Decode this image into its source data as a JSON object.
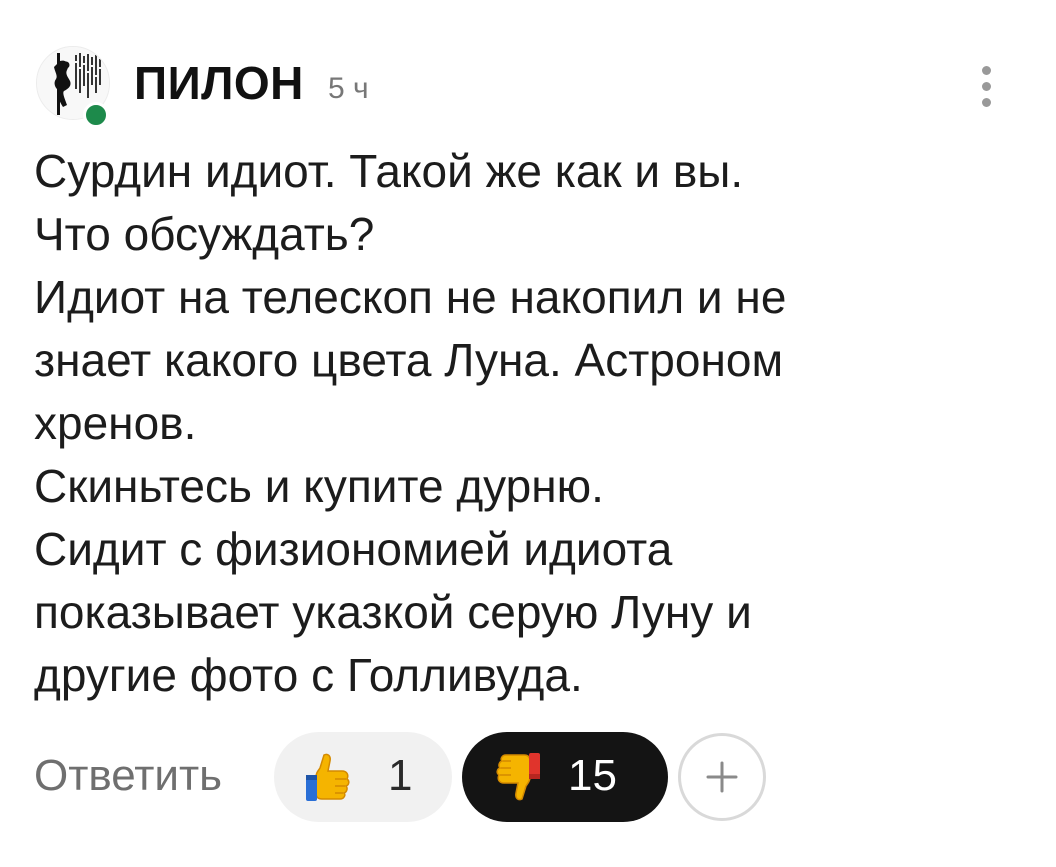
{
  "comment": {
    "author": "ПИЛОН",
    "timestamp": "5 ч",
    "avatar_icon": "pole-dancer-silhouette-icon",
    "online": true,
    "online_color": "#1d8a4b",
    "menu_icon": "more-vertical-icon",
    "lines": [
      "Сурдин идиот. Такой же как и вы.",
      "Что обсуждать?",
      "Идиот на телескоп не накопил и не",
      "знает какого цвета Луна. Астроном",
      "хренов.",
      "Скиньтесь и купите дурню.",
      "Сидит с физиономией идиота",
      "показывает указкой серую Луну и",
      "другие фото с Голливуда."
    ]
  },
  "actions": {
    "reply_label": "Ответить",
    "upvote": {
      "icon": "thumbs-up-icon",
      "count": "1",
      "selected": false
    },
    "downvote": {
      "icon": "thumbs-down-icon",
      "count": "15",
      "selected": true
    },
    "add_reaction_icon": "plus-icon"
  },
  "colors": {
    "text": "#1c1c1c",
    "muted": "#777777",
    "pill_light": "#f1f1f1",
    "pill_dark": "#141414",
    "emoji_yellow": "#f5b400"
  }
}
